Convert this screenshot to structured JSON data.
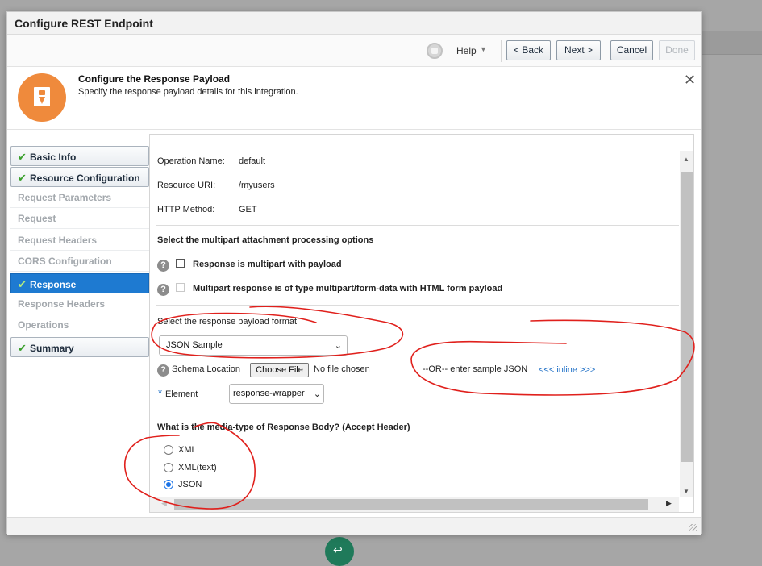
{
  "dialog": {
    "title": "Configure REST Endpoint"
  },
  "toolbar": {
    "help_label": "Help",
    "back_label": "< Back",
    "next_label": "Next >",
    "cancel_label": "Cancel",
    "done_label": "Done"
  },
  "header": {
    "title": "Configure the Response Payload",
    "subtitle": "Specify the response payload details for this integration."
  },
  "nav": {
    "items": [
      {
        "label": "Basic Info",
        "state": "done"
      },
      {
        "label": "Resource Configuration",
        "state": "done"
      },
      {
        "label": "Request Parameters",
        "state": "disabled"
      },
      {
        "label": "Request",
        "state": "disabled"
      },
      {
        "label": "Request Headers",
        "state": "disabled"
      },
      {
        "label": "CORS Configuration",
        "state": "disabled"
      },
      {
        "label": "Response",
        "state": "active"
      },
      {
        "label": "Response Headers",
        "state": "disabled"
      },
      {
        "label": "Operations",
        "state": "disabled"
      },
      {
        "label": "Summary",
        "state": "done"
      }
    ]
  },
  "form": {
    "operation_name_label": "Operation Name:",
    "operation_name_value": "default",
    "resource_uri_label": "Resource URI:",
    "resource_uri_value": "/myusers",
    "http_method_label": "HTTP Method:",
    "http_method_value": "GET",
    "multipart_heading": "Select the multipart attachment processing options",
    "multipart_option_1": "Response is multipart with payload",
    "multipart_option_2": "Multipart response is of type multipart/form-data with HTML form payload",
    "payload_format_heading": "Select the response payload format",
    "payload_format_value": "JSON Sample",
    "schema_location_label": "Schema Location",
    "choose_file_label": "Choose File",
    "no_file_text": "No file chosen",
    "or_sample_text": "--OR-- enter sample JSON",
    "inline_link": "<<< inline >>>",
    "element_required_marker": "*",
    "element_label": "Element",
    "element_value": "response-wrapper",
    "media_type_heading": "What is the media-type of Response Body? (Accept Header)",
    "media_types": [
      {
        "label": "XML",
        "checked": false
      },
      {
        "label": "XML(text)",
        "checked": false
      },
      {
        "label": "JSON",
        "checked": true
      }
    ]
  },
  "colors": {
    "accent": "#1e7ad1",
    "icon_orange": "#ef8a3c",
    "annotation_red": "#e0201c",
    "check_green": "#3aa02c"
  }
}
